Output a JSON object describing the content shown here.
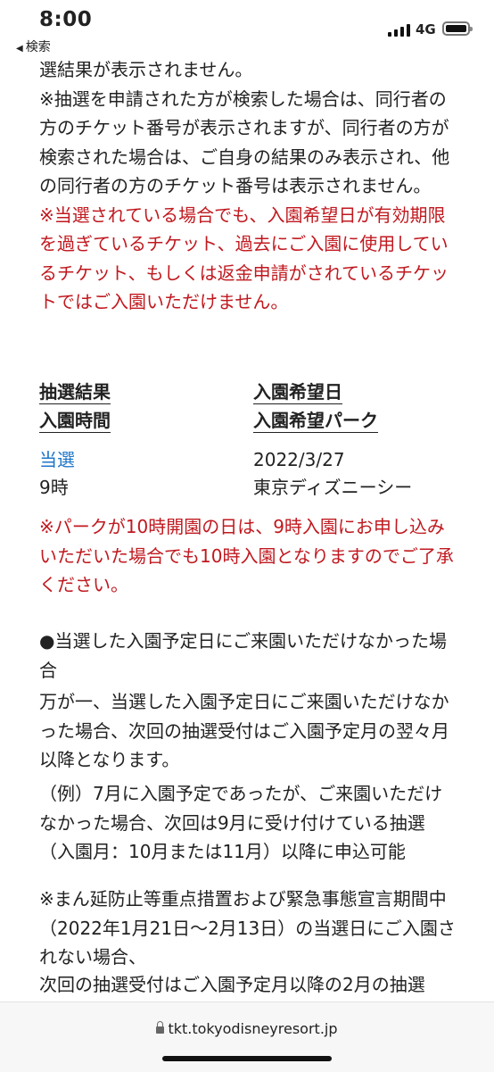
{
  "status_bar": {
    "time": "8:00",
    "back_label": "検索",
    "network": "4G",
    "icons": [
      "signal-icon",
      "battery-icon",
      "back-arrow-icon"
    ]
  },
  "content": {
    "intro_lines": [
      "選結果が表示されません。",
      "※抽選を申請された方が検索した場合は、同行者の方のチケット番号が表示されますが、同行者の方が検索された場合は、ご自身の結果のみ表示され、他の同行者の方のチケット番号は表示されません。"
    ],
    "red_notice": "※当選されている場合でも、入園希望日が有効期限を過ぎているチケット、過去にご入園に使用しているチケット、もしくは返金申請がされているチケットではご入園いただけません。",
    "result_table": {
      "header_left_1": "抽選結果",
      "header_left_2": "入園時間",
      "header_right_1": "入園希望日",
      "header_right_2": "入園希望パーク",
      "value_result": "当選",
      "value_time": "9時",
      "value_date": "2022/3/27",
      "value_park": "東京ディズニーシー"
    },
    "red_notice_2": "※パークが10時開園の日は、9時入園にお申し込みいただいた場合でも10時入園となりますのでご了承ください。",
    "section_heading": "●当選した入園予定日にご来園いただけなかった場合",
    "section_body": "万が一、当選した入園予定日にご来園いただけなかった場合、次回の抽選受付はご入園予定月の翌々月以降となります。",
    "example": "（例）7月に入園予定であったが、ご来園いただけなかった場合、次回は9月に受け付けている抽選（入園月：10月または11月）以降に申込可能",
    "emergency_1": "※まん延防止等重点措置および緊急事態宣言期間中（2022年1月21日〜2月13日）の当選日にご入園されない場合、",
    "emergency_2": "次回の抽選受付はご入園予定月以降の2月の抽選"
  },
  "footer": {
    "url": "tkt.tokyodisneyresort.jp"
  }
}
